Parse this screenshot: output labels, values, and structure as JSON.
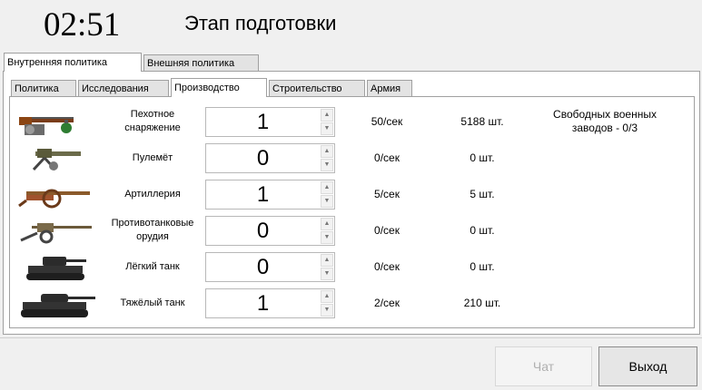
{
  "header": {
    "timer": "02:51",
    "phase_title": "Этап подготовки"
  },
  "outer_tabs": [
    {
      "label": "Внутренняя политика",
      "active": true
    },
    {
      "label": "Внешняя политика",
      "active": false
    }
  ],
  "inner_tabs": [
    {
      "label": "Политика",
      "active": false
    },
    {
      "label": "Исследования",
      "active": false
    },
    {
      "label": "Производство",
      "active": true
    },
    {
      "label": "Строительство",
      "active": false
    },
    {
      "label": "Армия",
      "active": false
    }
  ],
  "production": [
    {
      "icon": "rifle-grenade-icon",
      "name": "Пехотное снаряжение",
      "quantity": "1",
      "rate": "50/сек",
      "count": "5188 шт."
    },
    {
      "icon": "machine-gun-icon",
      "name": "Пулемёт",
      "quantity": "0",
      "rate": "0/сек",
      "count": "0 шт."
    },
    {
      "icon": "artillery-icon",
      "name": "Артиллерия",
      "quantity": "1",
      "rate": "5/сек",
      "count": "5 шт."
    },
    {
      "icon": "anti-tank-gun-icon",
      "name": "Противотанковые орудия",
      "quantity": "0",
      "rate": "0/сек",
      "count": "0 шт."
    },
    {
      "icon": "light-tank-icon",
      "name": "Лёгкий танк",
      "quantity": "0",
      "rate": "0/сек",
      "count": "0 шт."
    },
    {
      "icon": "heavy-tank-icon",
      "name": "Тяжёлый танк",
      "quantity": "1",
      "rate": "2/сек",
      "count": "210 шт."
    }
  ],
  "factories_text": "Свободных военных заводов - 0/3",
  "buttons": {
    "chat": "Чат",
    "exit": "Выход"
  }
}
